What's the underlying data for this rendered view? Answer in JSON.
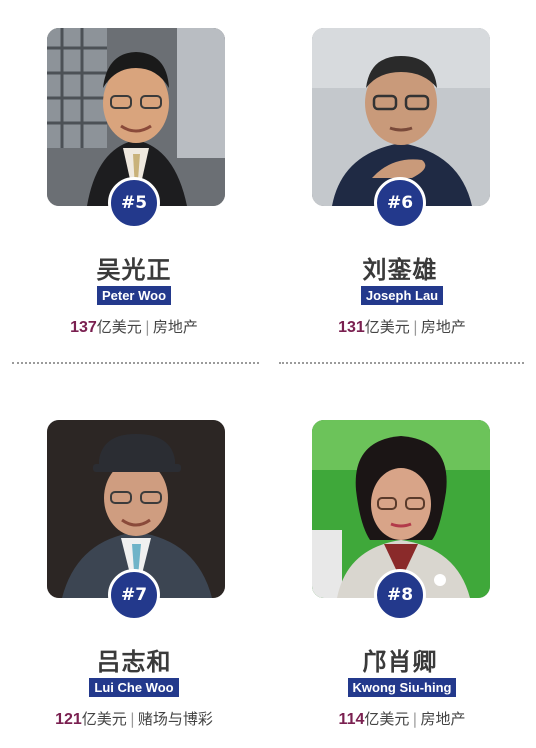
{
  "people": [
    {
      "rank": "#5",
      "name_cn": "吴光正",
      "name_en": "Peter Woo",
      "worth": "137",
      "unit": "亿美元",
      "industry": "房地产"
    },
    {
      "rank": "#6",
      "name_cn": "刘銮雄",
      "name_en": "Joseph Lau",
      "worth": "131",
      "unit": "亿美元",
      "industry": "房地产"
    },
    {
      "rank": "#7",
      "name_cn": "吕志和",
      "name_en": "Lui Che Woo",
      "worth": "121",
      "unit": "亿美元",
      "industry": "赌场与博彩"
    },
    {
      "rank": "#8",
      "name_cn": "邝肖卿",
      "name_en": "Kwong Siu-hing",
      "worth": "114",
      "unit": "亿美元",
      "industry": "房地产"
    }
  ],
  "separator": "|",
  "colors": {
    "badge": "#23398c",
    "worth": "#7a2050",
    "divider": "#9b9b9b"
  }
}
